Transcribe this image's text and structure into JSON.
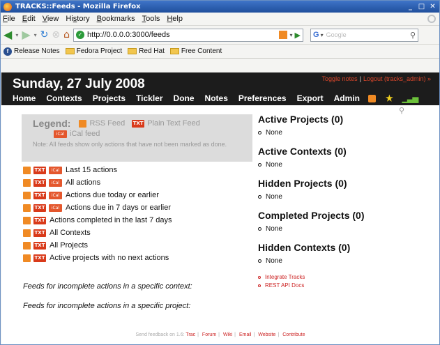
{
  "window": {
    "title": "TRACKS::Feeds - Mozilla Firefox"
  },
  "menubar": {
    "items": [
      {
        "key": "F",
        "rest": "ile"
      },
      {
        "key": "E",
        "rest": "dit"
      },
      {
        "key": "V",
        "rest": "iew"
      },
      {
        "pre": "Hi",
        "key": "s",
        "rest": "tory"
      },
      {
        "key": "B",
        "rest": "ookmarks"
      },
      {
        "key": "T",
        "rest": "ools"
      },
      {
        "key": "H",
        "rest": "elp"
      }
    ]
  },
  "navigation": {
    "url": "http://0.0.0.0:3000/feeds",
    "search_placeholder": "Google"
  },
  "bookmarks": [
    "Release Notes",
    "Fedora Project",
    "Red Hat",
    "Free Content"
  ],
  "header": {
    "date": "Sunday, 27 July 2008",
    "toggle_notes": "Toggle notes",
    "logout": "Logout (tracks_admin) »",
    "nav": [
      "Home",
      "Contexts",
      "Projects",
      "Tickler",
      "Done",
      "Notes",
      "Preferences",
      "Export",
      "Admin"
    ]
  },
  "legend": {
    "title": "Legend:",
    "rss_label": "RSS Feed",
    "txt_label": "Plain Text Feed",
    "ical_label": "iCal feed",
    "note": "Note: All feeds show only actions that have not been marked as done.",
    "icon_rss": "RSS",
    "icon_txt": "TXT",
    "icon_ical": "iCal"
  },
  "feeds": [
    {
      "label": "Last 15 actions",
      "ical": true
    },
    {
      "label": "All actions",
      "ical": true
    },
    {
      "label": "Actions due today or earlier",
      "ical": true
    },
    {
      "label": "Actions due in 7 days or earlier",
      "ical": true
    },
    {
      "label": "Actions completed in the last 7 days",
      "ical": false
    },
    {
      "label": "All Contexts",
      "ical": false
    },
    {
      "label": "All Projects",
      "ical": false
    },
    {
      "label": "Active projects with no next actions",
      "ical": false
    }
  ],
  "specific": {
    "context": "Feeds for incomplete actions in a specific context:",
    "project": "Feeds for incomplete actions in a specific project:"
  },
  "sidebar": {
    "sections": [
      {
        "title": "Active Projects (0)",
        "item": "None"
      },
      {
        "title": "Active Contexts (0)",
        "item": "None"
      },
      {
        "title": "Hidden Projects (0)",
        "item": "None"
      },
      {
        "title": "Completed Projects (0)",
        "item": "None"
      },
      {
        "title": "Hidden Contexts (0)",
        "item": "None"
      }
    ],
    "links": [
      "Integrate Tracks",
      "REST API Docs"
    ]
  },
  "footer": {
    "prefix": "Send feedback on 1.6:",
    "links": [
      "Trac",
      "Forum",
      "Wiki",
      "Email",
      "Website",
      "Contribute"
    ]
  },
  "colors": {
    "header_bg": "#1c1c1c",
    "link_red": "#cc2222",
    "rss_orange": "#f08a24",
    "txt_red": "#d93a1a"
  }
}
